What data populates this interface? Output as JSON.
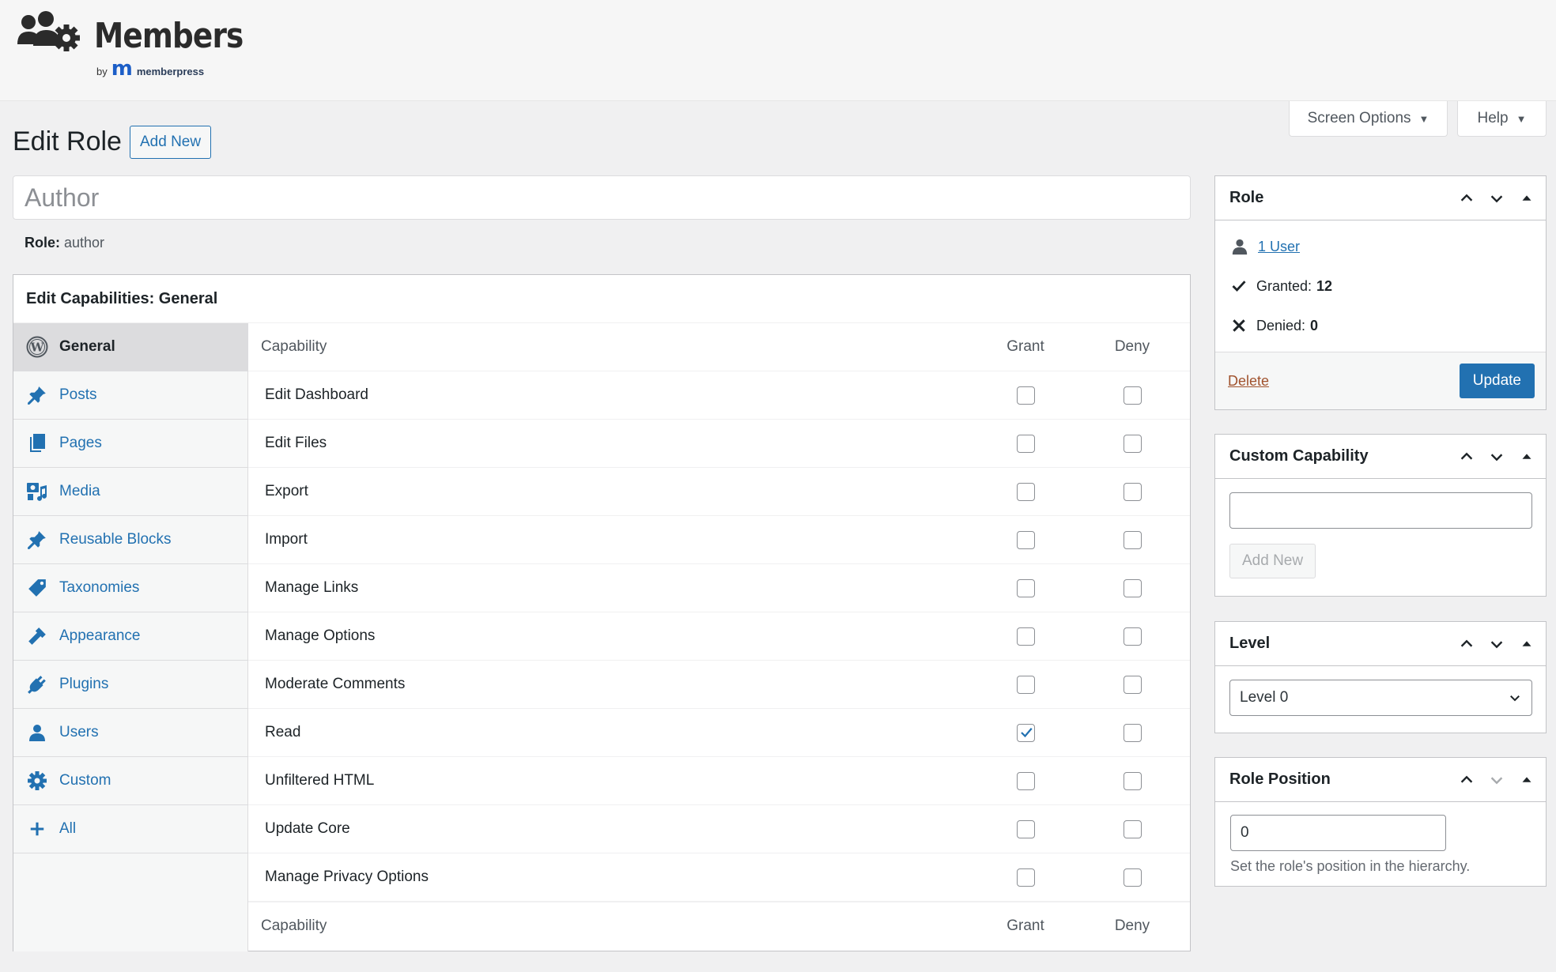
{
  "brand": {
    "name": "Members",
    "by_label": "by",
    "by_mark": "m",
    "by_company": "memberpress"
  },
  "top_tabs": {
    "screen_options": "Screen Options",
    "help": "Help"
  },
  "page": {
    "title": "Edit Role",
    "add_new": "Add New",
    "role_name_value": "Author",
    "role_slug_label": "Role:",
    "role_slug_value": "author"
  },
  "capabilities": {
    "heading": "Edit Capabilities: General",
    "nav": [
      {
        "label": "General",
        "icon": "wordpress-icon",
        "active": true
      },
      {
        "label": "Posts",
        "icon": "pushpin-icon"
      },
      {
        "label": "Pages",
        "icon": "pages-icon"
      },
      {
        "label": "Media",
        "icon": "media-icon"
      },
      {
        "label": "Reusable Blocks",
        "icon": "pushpin-icon"
      },
      {
        "label": "Taxonomies",
        "icon": "tag-icon"
      },
      {
        "label": "Appearance",
        "icon": "paintbrush-icon"
      },
      {
        "label": "Plugins",
        "icon": "plugin-icon"
      },
      {
        "label": "Users",
        "icon": "user-icon"
      },
      {
        "label": "Custom",
        "icon": "gear-icon"
      },
      {
        "label": "All",
        "icon": "plus-icon"
      }
    ],
    "columns": {
      "capability": "Capability",
      "grant": "Grant",
      "deny": "Deny"
    },
    "rows": [
      {
        "label": "Edit Dashboard",
        "grant": false,
        "deny": false
      },
      {
        "label": "Edit Files",
        "grant": false,
        "deny": false
      },
      {
        "label": "Export",
        "grant": false,
        "deny": false
      },
      {
        "label": "Import",
        "grant": false,
        "deny": false
      },
      {
        "label": "Manage Links",
        "grant": false,
        "deny": false
      },
      {
        "label": "Manage Options",
        "grant": false,
        "deny": false
      },
      {
        "label": "Moderate Comments",
        "grant": false,
        "deny": false
      },
      {
        "label": "Read",
        "grant": true,
        "deny": false
      },
      {
        "label": "Unfiltered HTML",
        "grant": false,
        "deny": false
      },
      {
        "label": "Update Core",
        "grant": false,
        "deny": false
      },
      {
        "label": "Manage Privacy Options",
        "grant": false,
        "deny": false
      }
    ]
  },
  "role_box": {
    "title": "Role",
    "users_link": "1 User",
    "granted_label": "Granted:",
    "granted_count": "12",
    "denied_label": "Denied:",
    "denied_count": "0",
    "delete": "Delete",
    "update": "Update"
  },
  "custom_cap_box": {
    "title": "Custom Capability",
    "input_value": "",
    "add_new": "Add New"
  },
  "level_box": {
    "title": "Level",
    "selected": "Level 0"
  },
  "position_box": {
    "title": "Role Position",
    "value": "0",
    "help": "Set the role's position in the hierarchy."
  },
  "colors": {
    "accent": "#2271b1",
    "background": "#f0f0f1",
    "border": "#c3c4c7",
    "brand_blue": "#1c5ec7"
  }
}
